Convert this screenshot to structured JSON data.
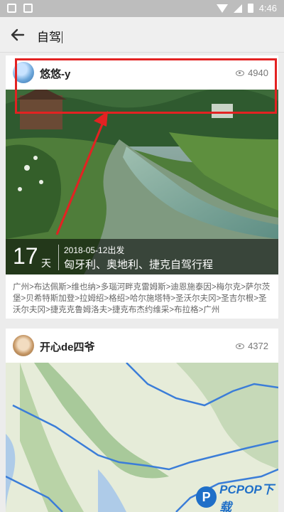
{
  "status_bar": {
    "time": "4:46"
  },
  "app_bar": {
    "search_query": "自驾"
  },
  "cards": [
    {
      "username": "悠悠-y",
      "views": "4940",
      "days_number": "17",
      "days_unit": "天",
      "date": "2018-05-12出发",
      "title": "匈牙利、奥地利、捷克自驾行程",
      "route": "广州>布达佩斯>维也纳>多瑙河畔克雷姆斯>迪恩施泰因>梅尔克>萨尔茨堡>贝希特斯加登>拉姆绍>格绍>哈尔施塔特>圣沃尔夫冈>圣吉尔根>圣沃尔夫冈>捷克克鲁姆洛夫>捷克布杰约维采>布拉格>广州"
    },
    {
      "username": "开心de四爷",
      "views": "4372"
    }
  ],
  "icons": {
    "back": "arrow-left-icon",
    "views": "eye-icon"
  },
  "colors": {
    "highlight": "#e32222",
    "watermark": "#1f6fc8"
  },
  "watermark": {
    "logo_letter": "P",
    "text": "PCPOP下载"
  }
}
